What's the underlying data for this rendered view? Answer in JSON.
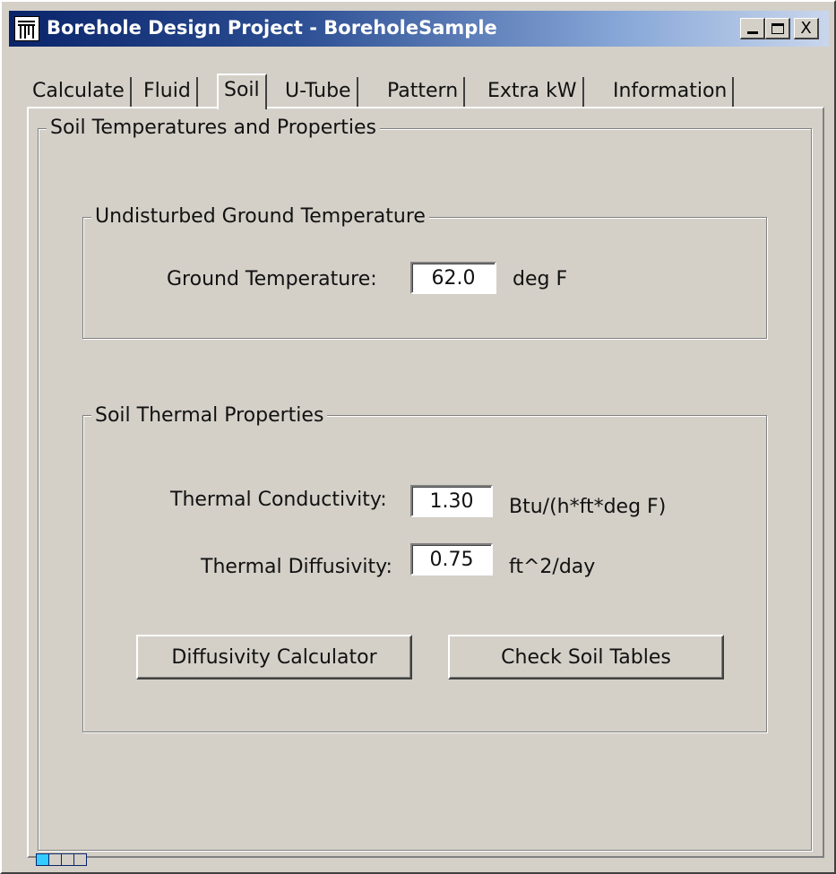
{
  "window": {
    "title": "Borehole Design Project - BoreholeSample",
    "icon": "borehole-app-icon",
    "controls": {
      "minimize": "minimize-icon",
      "maximize": "maximize-icon",
      "close_label": "X"
    }
  },
  "tabs": [
    {
      "label": "Calculate",
      "active": false
    },
    {
      "label": "Fluid",
      "active": false
    },
    {
      "label": "Soil",
      "active": true
    },
    {
      "label": "U-Tube",
      "active": false
    },
    {
      "label": "Pattern",
      "active": false
    },
    {
      "label": "Extra kW",
      "active": false
    },
    {
      "label": "Information",
      "active": false
    }
  ],
  "page": {
    "title": "Soil Temperatures and Properties",
    "ground_group": {
      "title": "Undisturbed Ground Temperature",
      "ground_temp_label": "Ground Temperature:",
      "ground_temp_value": "62.0",
      "ground_temp_unit": "deg F"
    },
    "thermal_group": {
      "title": "Soil Thermal Properties",
      "conductivity_label": "Thermal Conductivity:",
      "conductivity_value": "1.30",
      "conductivity_unit": "Btu/(h*ft*deg F)",
      "diffusivity_label": "Thermal Diffusivity:",
      "diffusivity_value": "0.75",
      "diffusivity_unit": "ft^2/day",
      "diffusivity_calc_button": "Diffusivity Calculator",
      "soil_tables_button": "Check Soil Tables"
    }
  },
  "status": {
    "indicator_cells": 4,
    "active_cells": 1,
    "active_color": "#33ccff"
  }
}
